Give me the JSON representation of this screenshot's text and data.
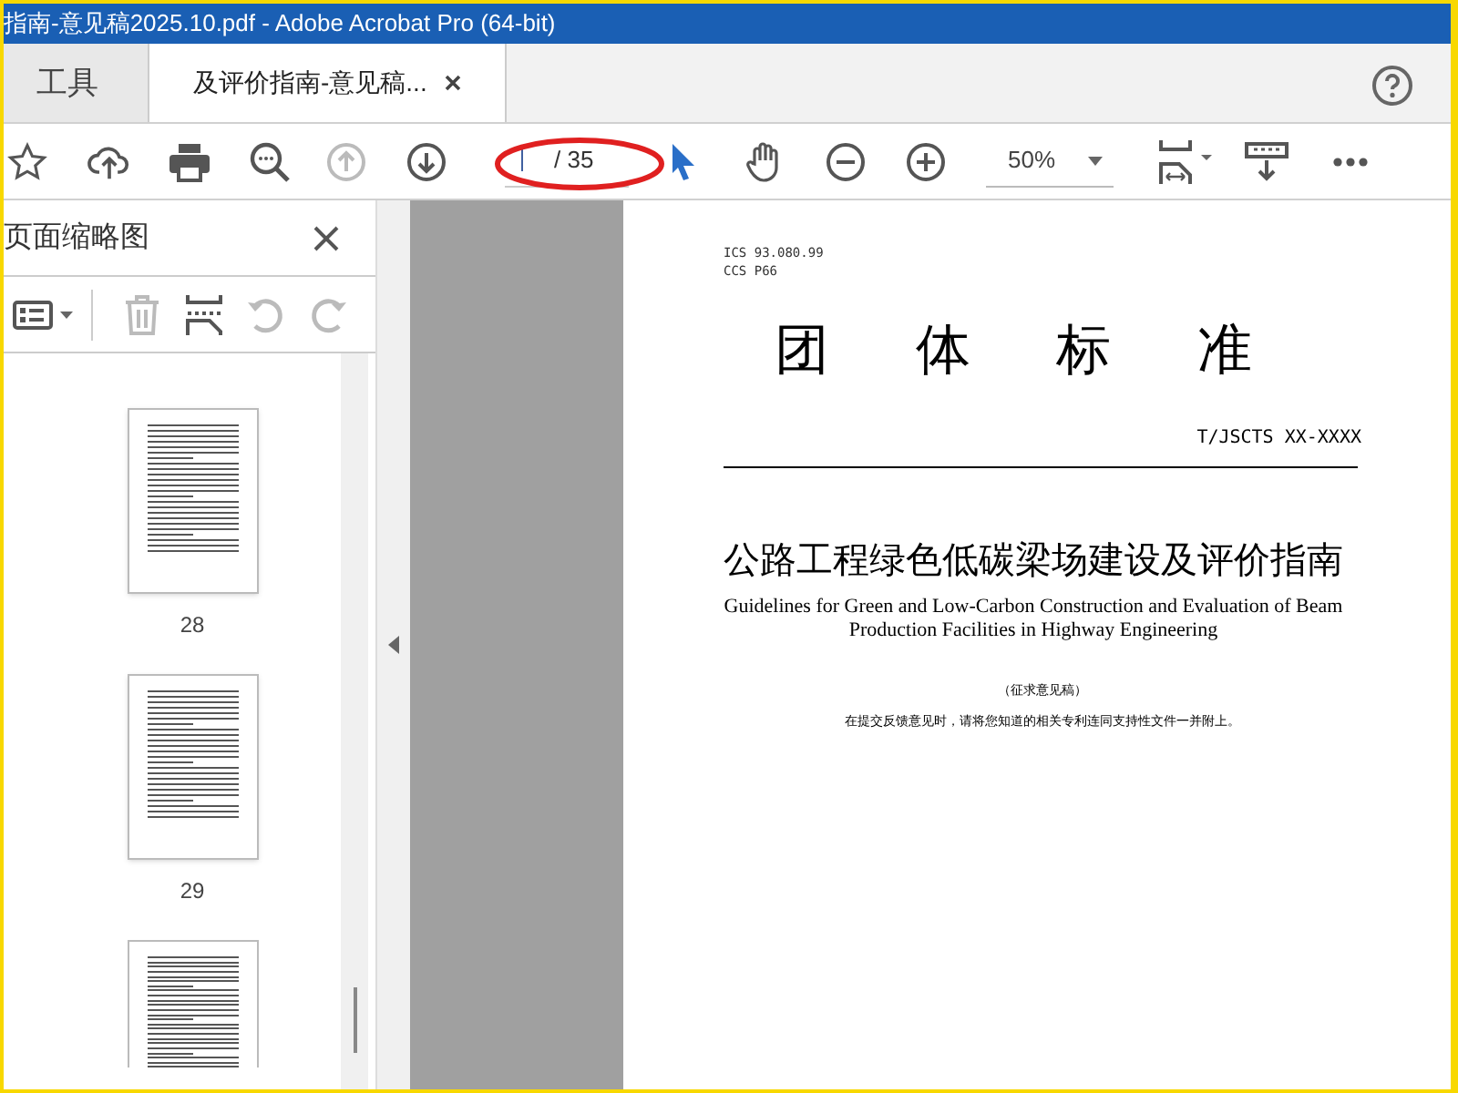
{
  "window": {
    "title": "指南-意见稿2025.10.pdf - Adobe Acrobat Pro (64-bit)"
  },
  "tabs": [
    {
      "label": "工具",
      "selected": false
    },
    {
      "label": "及评价指南-意见稿...",
      "selected": true,
      "closable": true
    }
  ],
  "toolbar": {
    "page_total": "/ 35",
    "zoom": "50%"
  },
  "thumbnails_panel": {
    "title": "页面缩略图",
    "pages": [
      {
        "label": "28",
        "partial": false
      },
      {
        "label": "29",
        "partial": false
      },
      {
        "partial": true
      }
    ]
  },
  "document": {
    "ics": "ICS 93.080.99",
    "ccs": "CCS P66",
    "heading": [
      "团",
      "体",
      "标",
      "准"
    ],
    "code": "T/JSCTS XX-XXXX",
    "title_cn": "公路工程绿色低碳梁场建设及评价指南",
    "title_en": "Guidelines for Green and Low-Carbon Construction and Evaluation of Beam Production Facilities in Highway Engineering",
    "draft": "（征求意见稿）",
    "notice": "在提交反馈意见时，请将您知道的相关专利连同支持性文件一并附上。"
  }
}
